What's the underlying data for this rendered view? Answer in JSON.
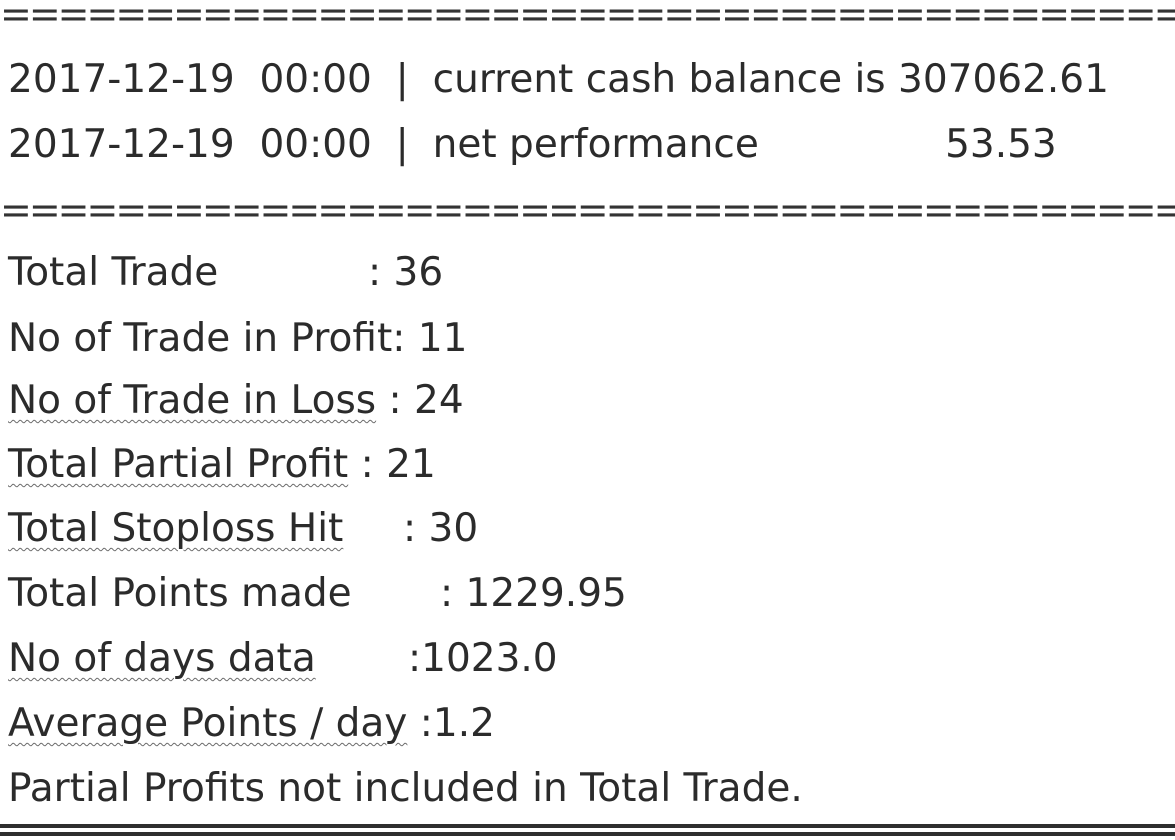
{
  "separator_text": "====================================================",
  "header_lines": [
    {
      "datetime": "2017-12-19  00:00",
      "divider": "|",
      "label": "current cash balance is",
      "value": "307062.61"
    },
    {
      "datetime": "2017-12-19  00:00",
      "divider": "|",
      "label": "net performance",
      "value": "53.53"
    }
  ],
  "stats": [
    {
      "label": "Total Trade",
      "colon": ":",
      "value": "36"
    },
    {
      "label": "No of Trade in Profit",
      "colon": ":",
      "value": "11"
    },
    {
      "label": "No of Trade in Loss",
      "colon": ":",
      "value": "24"
    },
    {
      "label": "Total Partial Profit",
      "colon": ":",
      "value": "21"
    },
    {
      "label": "Total Stoploss Hit",
      "colon": ":",
      "value": "30"
    },
    {
      "label": "Total Points made",
      "colon": ":",
      "value": "1229.95"
    },
    {
      "label": "No of days data",
      "colon": ":",
      "value": "1023.0"
    },
    {
      "label": "Average Points / day",
      "colon": ":",
      "value": "1.2"
    }
  ],
  "footer_note": "Partial Profits not included in Total Trade."
}
